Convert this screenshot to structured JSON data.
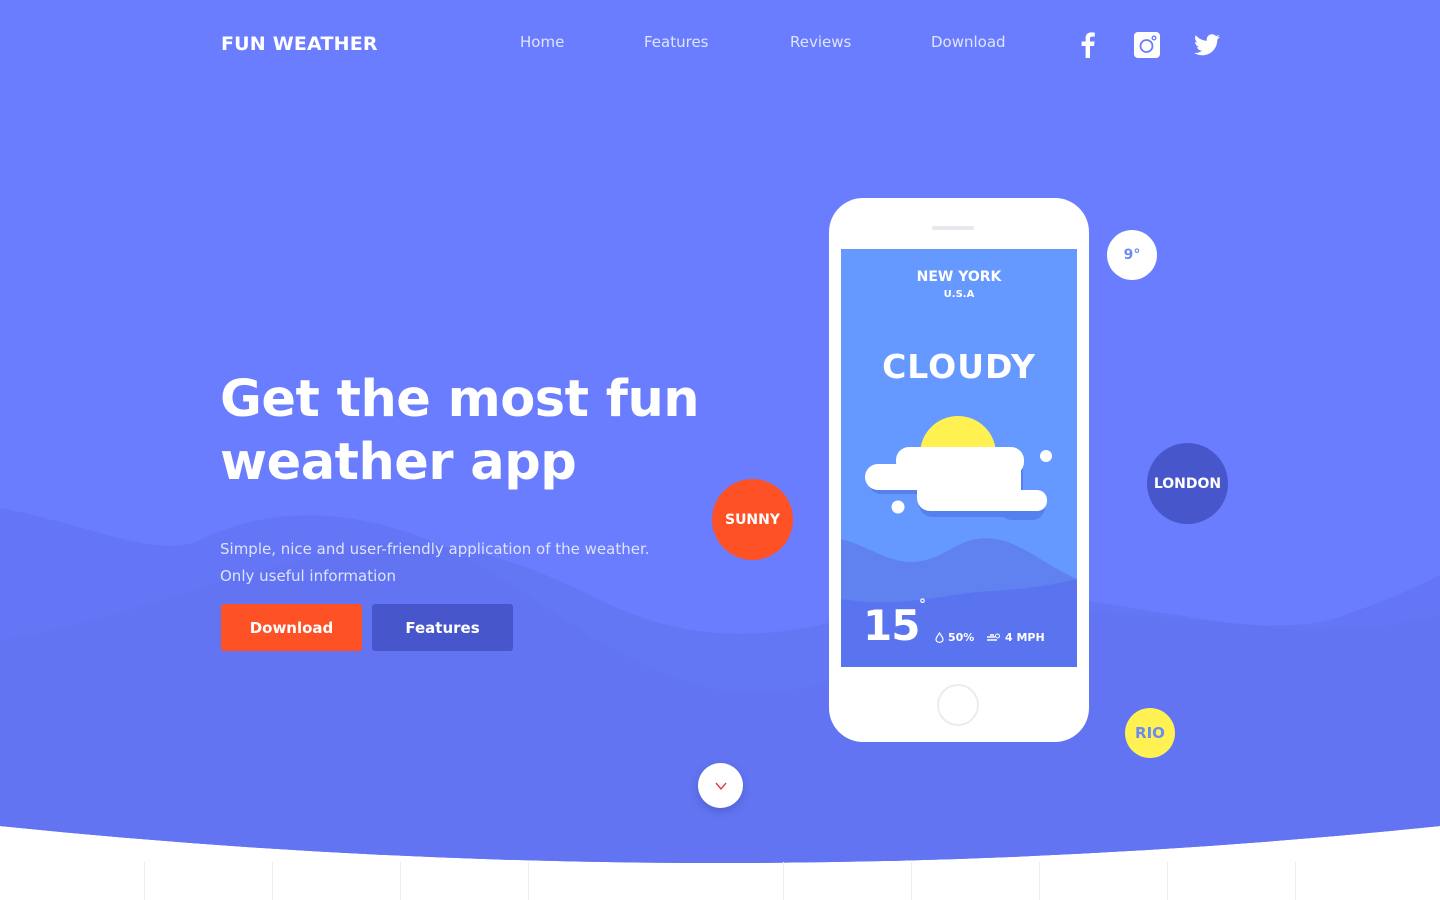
{
  "header": {
    "logo": "FUN WEATHER",
    "nav": [
      "Home",
      "Features",
      "Reviews",
      "Download"
    ],
    "social": [
      "facebook-icon",
      "instagram-icon",
      "twitter-icon"
    ]
  },
  "hero": {
    "headline_line1": "Get the most fun",
    "headline_line2": "weather app",
    "subtitle_line1": "Simple, nice and user-friendly application of the weather.",
    "subtitle_line2": "Only useful information",
    "download_label": "Download",
    "features_label": "Features"
  },
  "phone": {
    "city": "NEW YORK",
    "country": "U.S.A",
    "condition": "CLOUDY",
    "temperature": "15",
    "degree": "°",
    "humidity": "50%",
    "wind": "4 MPH"
  },
  "bubbles": {
    "sunny": "SUNNY",
    "nine": "9°",
    "london": "LONDON",
    "rio": "RIO"
  },
  "scroll": {
    "icon": "v"
  },
  "colors": {
    "primary": "#6a7dfe",
    "accent": "#ff5126",
    "secondary": "#4856cc",
    "sun": "#fff152"
  }
}
